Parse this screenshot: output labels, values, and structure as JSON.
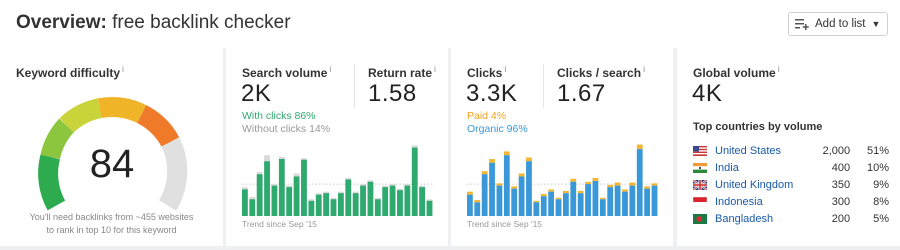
{
  "header": {
    "title_bold": "Overview:",
    "title_query": "free backlink checker",
    "add_to_list": "Add to list"
  },
  "keyword_difficulty": {
    "label": "Keyword difficulty",
    "info": "i",
    "value": "84",
    "note_line1": "You'll need backlinks from ~455 websites",
    "note_line2": "to rank in top 10 for this keyword"
  },
  "search_volume": {
    "label": "Search volume",
    "info": "i",
    "value": "2K",
    "with_clicks": "With clicks 86%",
    "without_clicks": "Without clicks 14%",
    "trend": "Trend since Sep '15",
    "bars": [
      0.35,
      0.22,
      0.55,
      0.72,
      0.4,
      0.75,
      0.38,
      0.52,
      0.74,
      0.2,
      0.28,
      0.3,
      0.22,
      0.3,
      0.48,
      0.3,
      0.4,
      0.45,
      0.22,
      0.38,
      0.4,
      0.34,
      0.4,
      0.9,
      0.38,
      0.2
    ],
    "bars_grey": [
      0.38,
      0.25,
      0.58,
      0.8,
      0.42,
      0.78,
      0.4,
      0.56,
      0.76,
      0.22,
      0.3,
      0.32,
      0.24,
      0.32,
      0.5,
      0.32,
      0.42,
      0.47,
      0.24,
      0.4,
      0.42,
      0.36,
      0.42,
      0.93,
      0.4,
      0.22
    ]
  },
  "return_rate": {
    "label": "Return rate",
    "info": "i",
    "value": "1.58"
  },
  "clicks": {
    "label": "Clicks",
    "info": "i",
    "value": "3.3K",
    "paid": "Paid 4%",
    "organic": "Organic 96%",
    "trend": "Trend since Sep '15",
    "bars": [
      0.28,
      0.18,
      0.55,
      0.7,
      0.4,
      0.8,
      0.36,
      0.52,
      0.72,
      0.18,
      0.26,
      0.32,
      0.22,
      0.3,
      0.45,
      0.3,
      0.42,
      0.46,
      0.22,
      0.38,
      0.4,
      0.32,
      0.4,
      0.88,
      0.36,
      0.4
    ],
    "bars_paid": [
      0.04,
      0.03,
      0.04,
      0.05,
      0.03,
      0.05,
      0.03,
      0.04,
      0.05,
      0.02,
      0.03,
      0.03,
      0.02,
      0.03,
      0.04,
      0.03,
      0.03,
      0.04,
      0.02,
      0.03,
      0.04,
      0.03,
      0.04,
      0.06,
      0.03,
      0.03
    ]
  },
  "clicks_per_search": {
    "label": "Clicks / search",
    "info": "i",
    "value": "1.67"
  },
  "global_volume": {
    "label": "Global volume",
    "info": "i",
    "value": "4K",
    "countries_title": "Top countries by volume",
    "countries": [
      {
        "name": "United States",
        "volume": "2,000",
        "share": "51%"
      },
      {
        "name": "India",
        "volume": "400",
        "share": "10%"
      },
      {
        "name": "United Kingdom",
        "volume": "350",
        "share": "9%"
      },
      {
        "name": "Indonesia",
        "volume": "300",
        "share": "8%"
      },
      {
        "name": "Bangladesh",
        "volume": "200",
        "share": "5%"
      }
    ]
  },
  "colors": {
    "green": "#2eaa6e",
    "blue": "#3a98d8",
    "paid": "#f2b632",
    "grey_bar": "#d9d9d9",
    "link": "#1a5aa8"
  }
}
